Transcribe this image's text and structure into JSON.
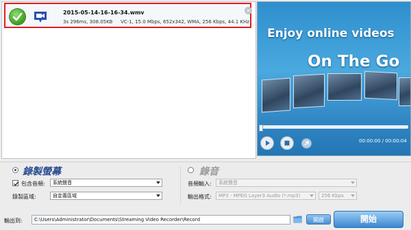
{
  "file_item": {
    "name": "2015-05-14-16-16-34.wmv",
    "meta": "3s 296ms, 308.05KB",
    "props": "VC-1, 15.0 Mbps, 652x342, WMA, 256 Kbps, 44.1 KHz",
    "close_glyph": "×"
  },
  "preview": {
    "promo_line1": "Enjoy online videos",
    "promo_line2": "On The Go",
    "time": "00:00:00 / 00:00:04"
  },
  "record_screen": {
    "title": "錄製螢幕",
    "include_audio_label": "包含音頻:",
    "audio_source_value": "系統聲音",
    "region_label": "錄製區域:",
    "region_value": "自定義區域"
  },
  "record_audio": {
    "title": "錄音",
    "audio_input_label": "音頻輸入:",
    "audio_input_value": "系統聲音",
    "output_format_label": "輸出格式:",
    "output_format_value": "MP3 - MPEG Layer3 Audio (*.mp3)",
    "bitrate_value": "256 Kbps"
  },
  "output": {
    "label": "輸出到:",
    "path": "C:\\Users\\Administrator\\Documents\\Streaming Video Recorder\\Record",
    "open_label": "開啟",
    "start_label": "開始"
  },
  "colors": {
    "highlight_border": "#e11d1d",
    "accent_blue": "#2f8fcd",
    "title_blue": "#2a4d8f"
  }
}
